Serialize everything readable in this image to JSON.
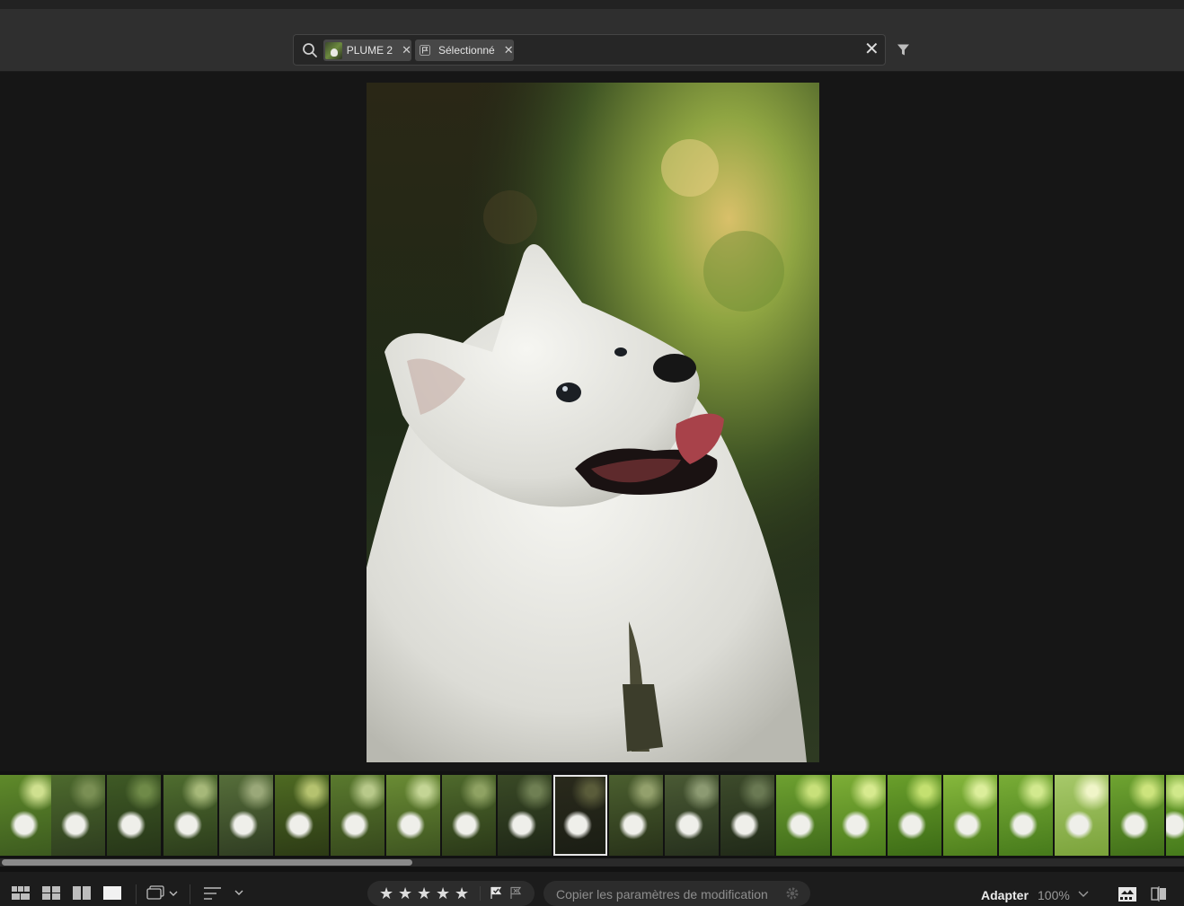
{
  "search": {
    "chips": [
      {
        "label": "PLUME 2",
        "icon": "album-thumbnail"
      },
      {
        "label": "Sélectionné",
        "icon": "flag-icon"
      }
    ]
  },
  "viewer": {
    "photo_subject": "white-dog"
  },
  "filmstrip": {
    "selected_index": 10,
    "thumbnail_count": 22
  },
  "toolbar": {
    "stars": [
      "★",
      "★",
      "★",
      "★",
      "★"
    ],
    "copy_label": "Copier les paramètres de modification",
    "fit_label": "Adapter",
    "zoom_label": "100%"
  },
  "colors": {
    "background": "#161616",
    "topbar": "#2f2f2f",
    "chip": "#474747"
  }
}
